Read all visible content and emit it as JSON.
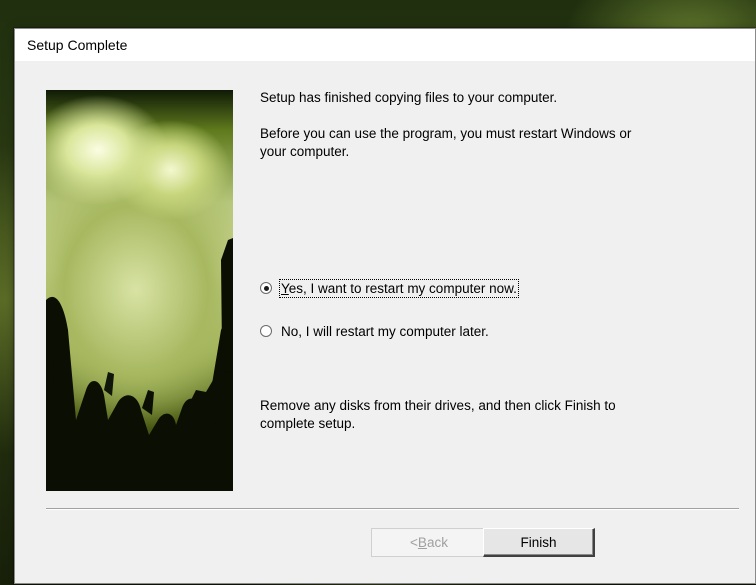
{
  "window": {
    "title": "Setup Complete"
  },
  "content": {
    "line1": "Setup has finished copying files to your computer.",
    "line2a": "Before you can use the program, you must restart Windows or",
    "line2b": "your computer.",
    "line3a": "Remove any disks from their drives, and then click Finish to",
    "line3b": "complete setup."
  },
  "options": {
    "restart_now": {
      "label_accel": "Y",
      "label_rest": "es, I want to restart my computer now.",
      "selected": true
    },
    "restart_later": {
      "label": "No, I will restart my computer later.",
      "selected": false
    }
  },
  "buttons": {
    "back_prefix": "< ",
    "back_accel": "B",
    "back_rest": "ack",
    "back_enabled": false,
    "finish": "Finish"
  },
  "icons": {
    "radio_selected": "radio-checked-icon",
    "radio_unselected": "radio-unchecked-icon"
  }
}
